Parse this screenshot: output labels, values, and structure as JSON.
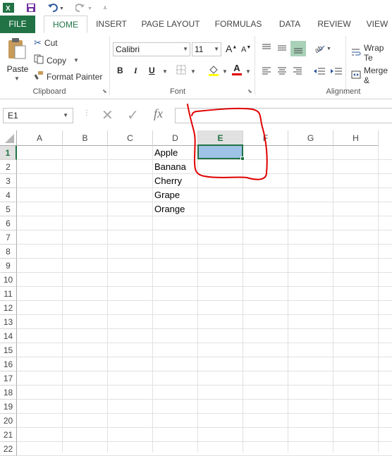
{
  "qat": {
    "app_icon": "excel-icon",
    "save_icon": "save-icon",
    "undo_icon": "undo-icon",
    "redo_icon": "redo-icon",
    "customize_icon": "customize-qat-icon"
  },
  "tabs": [
    {
      "label": "FILE"
    },
    {
      "label": "HOME"
    },
    {
      "label": "INSERT"
    },
    {
      "label": "PAGE LAYOUT"
    },
    {
      "label": "FORMULAS"
    },
    {
      "label": "DATA"
    },
    {
      "label": "REVIEW"
    },
    {
      "label": "VIEW"
    }
  ],
  "clipboard": {
    "paste": "Paste",
    "cut": "Cut",
    "copy": "Copy",
    "format_painter": "Format Painter",
    "group_label": "Clipboard"
  },
  "font": {
    "font_name": "Calibri",
    "font_size": "11",
    "grow": "A",
    "shrink": "A",
    "bold": "B",
    "italic": "I",
    "underline": "U",
    "font_color_letter": "A",
    "group_label": "Font"
  },
  "alignment": {
    "wrap_text": "Wrap Te",
    "merge": "Merge &",
    "group_label": "Alignment"
  },
  "formula_bar": {
    "name_box": "E1",
    "fx": "fx",
    "value": ""
  },
  "grid": {
    "columns": [
      "A",
      "B",
      "C",
      "D",
      "E",
      "F",
      "G",
      "H"
    ],
    "rows": [
      "1",
      "2",
      "3",
      "4",
      "5",
      "6",
      "7",
      "8",
      "9",
      "10",
      "11",
      "12",
      "13",
      "14",
      "15",
      "16",
      "17",
      "18",
      "19",
      "20",
      "21",
      "22"
    ],
    "selected_column": "E",
    "selected_row": "1",
    "column_d_values": [
      "Apple",
      "Banana",
      "Cherry",
      "Grape",
      "Orange"
    ]
  },
  "colors": {
    "accent": "#217346",
    "selection_fill": "#9fc3e7",
    "annotation": "#e00000"
  }
}
